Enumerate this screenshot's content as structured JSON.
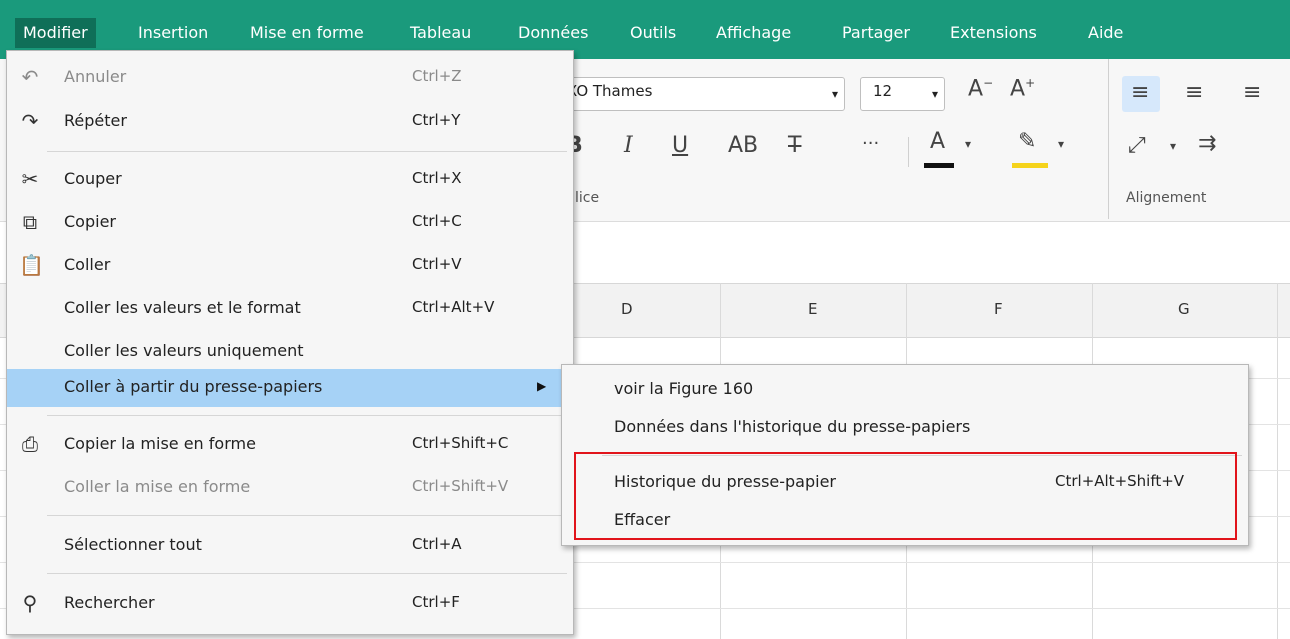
{
  "menubar": {
    "items": [
      {
        "label": "Modifier",
        "active": true
      },
      {
        "label": "Insertion"
      },
      {
        "label": "Mise en forme"
      },
      {
        "label": "Tableau"
      },
      {
        "label": "Données"
      },
      {
        "label": "Outils"
      },
      {
        "label": "Affichage"
      },
      {
        "label": "Partager"
      },
      {
        "label": "Extensions"
      },
      {
        "label": "Aide"
      }
    ],
    "accent": "#1a9a7c"
  },
  "ribbon": {
    "font_name": "XO Thames",
    "font_size": "12",
    "groups": [
      {
        "label": "lice"
      },
      {
        "label": "Alignement"
      }
    ],
    "underline_color": "#111111",
    "highlight_color": "#f5d31b"
  },
  "columns": [
    "D",
    "E",
    "F",
    "G"
  ],
  "edit_menu": {
    "items": [
      {
        "icon": "undo-icon",
        "label": "Annuler",
        "shortcut": "Ctrl+Z",
        "enabled": false
      },
      {
        "icon": "redo-icon",
        "label": "Répéter",
        "shortcut": "Ctrl+Y",
        "enabled": true
      },
      {
        "icon": "scissors-icon",
        "label": "Couper",
        "shortcut": "Ctrl+X",
        "enabled": true
      },
      {
        "icon": "copy-icon",
        "label": "Copier",
        "shortcut": "Ctrl+C",
        "enabled": true
      },
      {
        "icon": "paste-icon",
        "label": "Coller",
        "shortcut": "Ctrl+V",
        "enabled": true
      },
      {
        "label": "Coller les valeurs et le format",
        "shortcut": "Ctrl+Alt+V",
        "enabled": true
      },
      {
        "label": "Coller les valeurs uniquement",
        "shortcut": "",
        "enabled": true
      },
      {
        "label": "Coller à partir du presse-papiers",
        "submenu": true,
        "highlighted": true
      },
      {
        "icon": "format-painter-icon",
        "label": "Copier la mise en forme",
        "shortcut": "Ctrl+Shift+C",
        "enabled": true
      },
      {
        "label": "Coller la mise en forme",
        "shortcut": "Ctrl+Shift+V",
        "enabled": false
      },
      {
        "label": "Sélectionner tout",
        "shortcut": "Ctrl+A",
        "enabled": true
      },
      {
        "icon": "search-icon",
        "label": "Rechercher",
        "shortcut": "Ctrl+F",
        "enabled": true
      }
    ]
  },
  "clipboard_submenu": {
    "items": [
      {
        "label": "voir la Figure 160"
      },
      {
        "label": "Données dans l'historique du presse-papiers"
      },
      {
        "label": "Historique du presse-papier",
        "shortcut": "Ctrl+Alt+Shift+V"
      },
      {
        "label": "Effacer"
      }
    ],
    "annotation_color": "#e1141b"
  }
}
